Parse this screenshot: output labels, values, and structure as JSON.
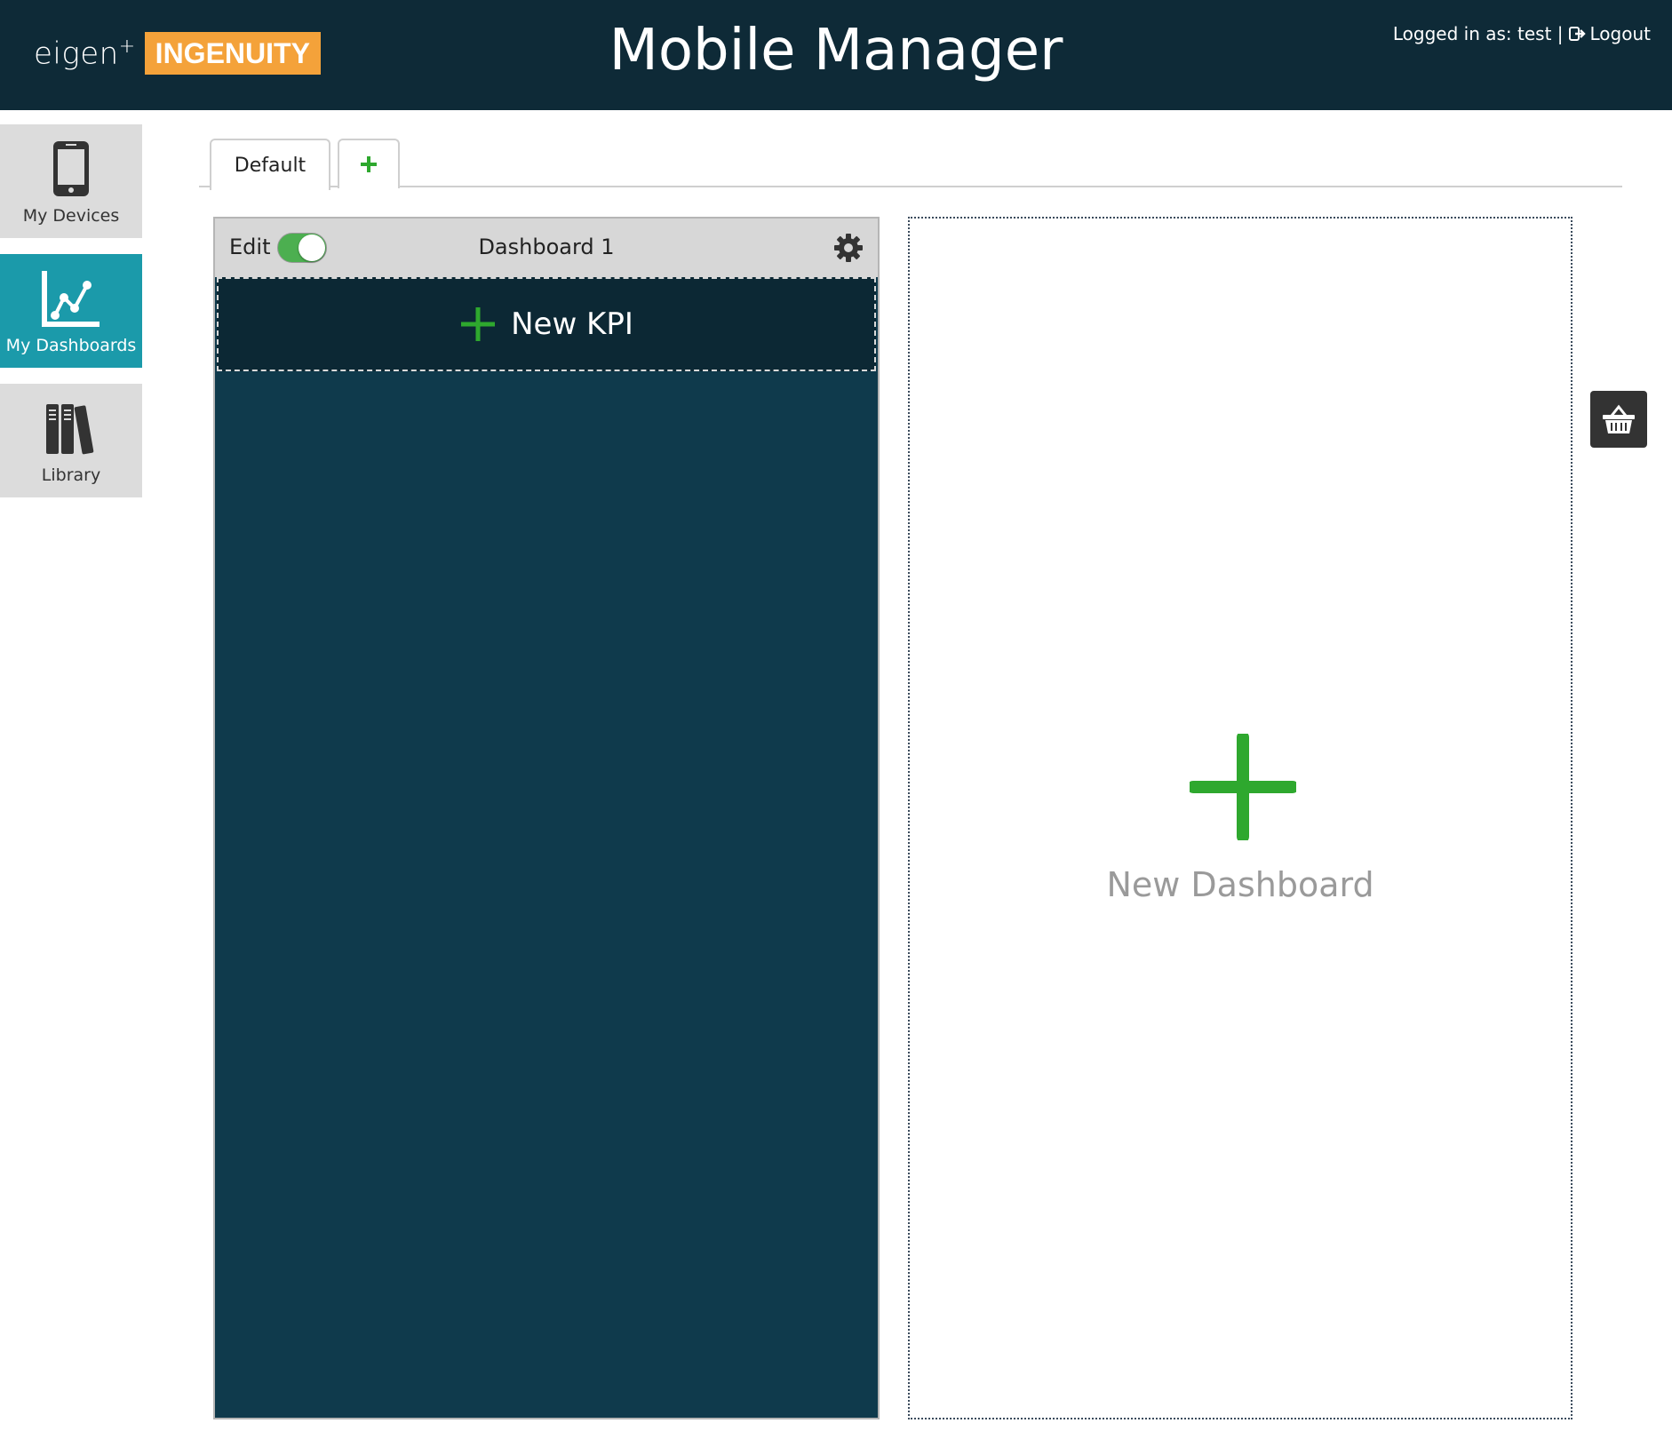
{
  "header": {
    "logo_prefix": "eigen",
    "logo_sup": "+",
    "logo_brand": "INGENUITY",
    "title": "Mobile Manager",
    "logged_in_text": "Logged in as: test |",
    "logout_label": "Logout"
  },
  "sidebar": {
    "items": [
      {
        "label": "My Devices",
        "icon": "phone-icon",
        "active": false
      },
      {
        "label": "My Dashboards",
        "icon": "chart-line-icon",
        "active": true
      },
      {
        "label": "Library",
        "icon": "books-icon",
        "active": false
      }
    ]
  },
  "tabs": {
    "items": [
      {
        "label": "Default",
        "active": true
      }
    ],
    "add_icon": "plus-icon"
  },
  "dashboard": {
    "edit_label": "Edit",
    "edit_enabled": true,
    "title": "Dashboard 1",
    "settings_icon": "gear-icon",
    "new_kpi_label": "New KPI"
  },
  "new_dashboard": {
    "label": "New Dashboard"
  },
  "basket": {
    "icon": "basket-icon"
  },
  "colors": {
    "header_bg": "#0e2a37",
    "brand_orange": "#f4a23a",
    "active_teal": "#1b9aaa",
    "phone_bg": "#0f3a4c",
    "accent_green": "#2ea82e"
  }
}
